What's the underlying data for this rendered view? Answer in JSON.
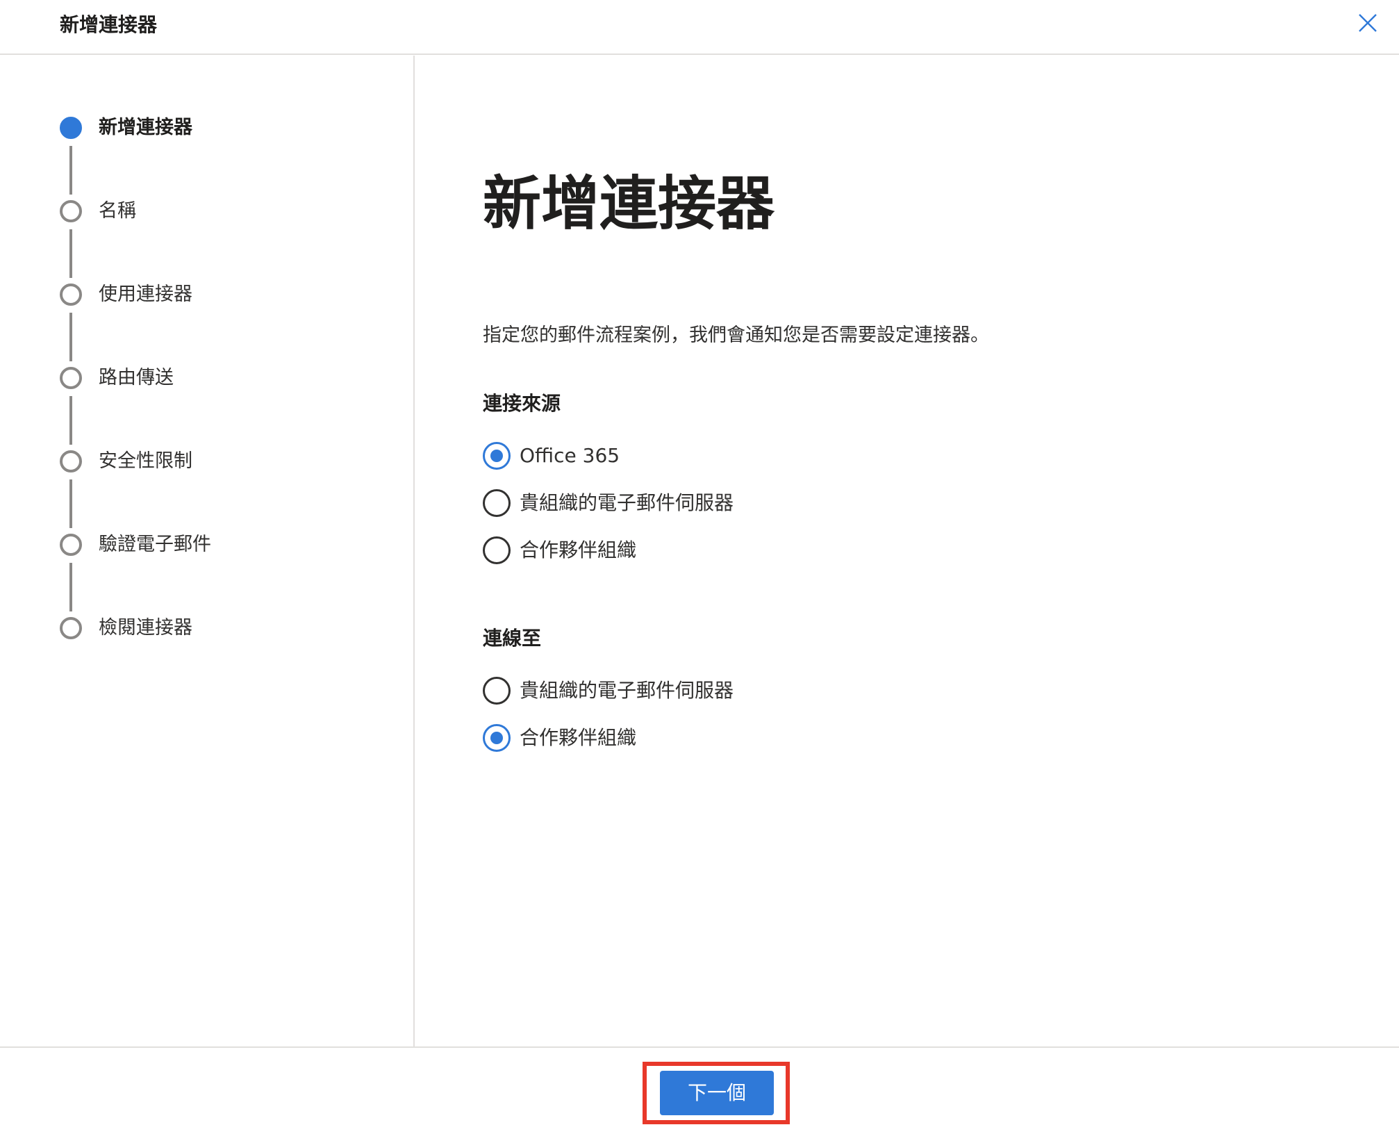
{
  "header": {
    "title": "新增連接器",
    "close_icon": "close-icon"
  },
  "steps": [
    {
      "label": "新增連接器",
      "state": "current"
    },
    {
      "label": "名稱",
      "state": "pending"
    },
    {
      "label": "使用連接器",
      "state": "pending"
    },
    {
      "label": "路由傳送",
      "state": "pending"
    },
    {
      "label": "安全性限制",
      "state": "pending"
    },
    {
      "label": "驗證電子郵件",
      "state": "pending"
    },
    {
      "label": "檢閱連接器",
      "state": "pending"
    }
  ],
  "main": {
    "title": "新增連接器",
    "description": "指定您的郵件流程案例，我們會通知您是否需要設定連接器。",
    "connection_from": {
      "label": "連接來源",
      "options": [
        {
          "label": "Office 365",
          "checked": true
        },
        {
          "label": "貴組織的電子郵件伺服器",
          "checked": false
        },
        {
          "label": "合作夥伴組織",
          "checked": false
        }
      ]
    },
    "connection_to": {
      "label": "連線至",
      "options": [
        {
          "label": "貴組織的電子郵件伺服器",
          "checked": false
        },
        {
          "label": "合作夥伴組織",
          "checked": true
        }
      ]
    }
  },
  "footer": {
    "next_label": "下一個"
  },
  "colors": {
    "accent": "#2f79d8",
    "highlight": "#e8382a",
    "divider": "#e1dfdd",
    "step_pending": "#8a8886"
  }
}
